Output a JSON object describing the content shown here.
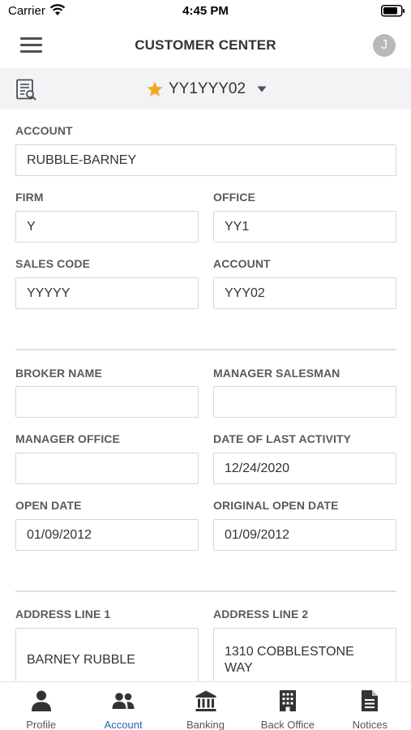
{
  "status_bar": {
    "carrier": "Carrier",
    "time": "4:45 PM"
  },
  "header": {
    "title": "CUSTOMER CENTER",
    "avatar_initial": "J"
  },
  "selector": {
    "account": "YY1YYY02",
    "star_color": "#f5a623"
  },
  "form": {
    "account_label": "ACCOUNT",
    "account_value": "RUBBLE-BARNEY",
    "firm_label": "FIRM",
    "firm_value": "Y",
    "office_label": "OFFICE",
    "office_value": "YY1",
    "sales_code_label": "SALES CODE",
    "sales_code_value": "YYYYY",
    "account2_label": "ACCOUNT",
    "account2_value": "YYY02",
    "broker_name_label": "BROKER NAME",
    "broker_name_value": "",
    "manager_salesman_label": "MANAGER SALESMAN",
    "manager_salesman_value": "",
    "manager_office_label": "MANAGER OFFICE",
    "manager_office_value": "",
    "last_activity_label": "DATE OF LAST ACTIVITY",
    "last_activity_value": "12/24/2020",
    "open_date_label": "OPEN DATE",
    "open_date_value": "01/09/2012",
    "original_open_date_label": "ORIGINAL OPEN DATE",
    "original_open_date_value": "01/09/2012",
    "address1_label": "ADDRESS LINE 1",
    "address1_value": "BARNEY RUBBLE",
    "address2_label": "ADDRESS LINE 2",
    "address2_line1": "1310 COBBLESTONE",
    "address2_line2": "WAY"
  },
  "tabs": [
    {
      "label": "Profile",
      "icon": "person-icon",
      "active": false
    },
    {
      "label": "Account",
      "icon": "people-icon",
      "active": true
    },
    {
      "label": "Banking",
      "icon": "bank-icon",
      "active": false
    },
    {
      "label": "Back Office",
      "icon": "building-icon",
      "active": false
    },
    {
      "label": "Notices",
      "icon": "document-icon",
      "active": false
    }
  ],
  "colors": {
    "active_tab": "#2466a8",
    "selector_bar": "#f2f3f4"
  }
}
